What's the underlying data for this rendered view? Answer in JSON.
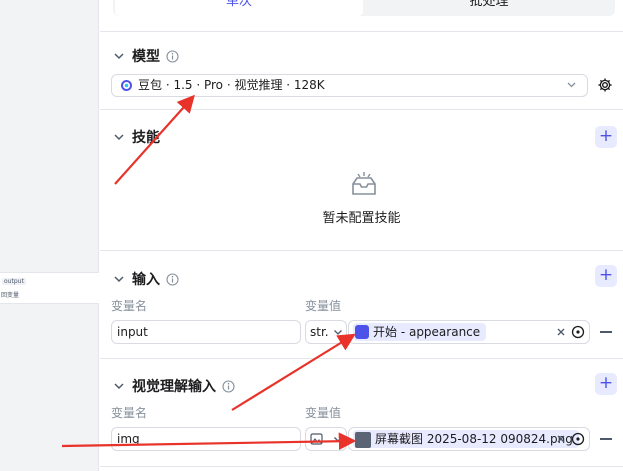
{
  "canvas": {
    "node_tag": "output",
    "node_sub": "回变量"
  },
  "mode_tabs": {
    "single": "单次",
    "batch": "批处理"
  },
  "model": {
    "title": "模型",
    "selected": "豆包 · 1.5 · Pro · 视觉推理 · 128K"
  },
  "skills": {
    "title": "技能",
    "empty_text": "暂未配置技能"
  },
  "input": {
    "title": "输入",
    "name_label": "变量名",
    "value_label": "变量值",
    "var_name": "input",
    "type": "str.",
    "ref_text": "开始 - appearance"
  },
  "vision_input": {
    "title": "视觉理解输入",
    "name_label": "变量名",
    "value_label": "变量值",
    "var_name": "img",
    "ref_text": "屏幕截图 2025-08-12 090824.png"
  },
  "colors": {
    "accent": "#4d53e8",
    "accent_bg": "#e8eaff",
    "arrow": "#e8322a"
  }
}
